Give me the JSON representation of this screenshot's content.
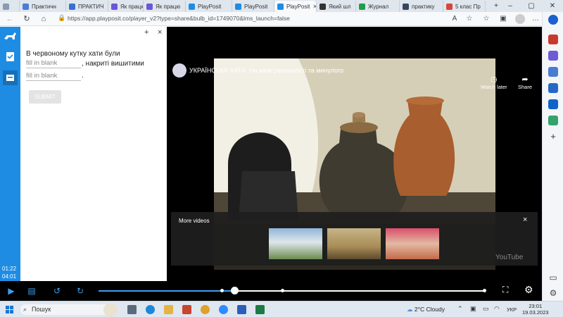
{
  "browser": {
    "tabs": [
      {
        "label": "Практичн",
        "favicon_color": "#4a7dd8",
        "active": false
      },
      {
        "label": "ПРАКТИЧ",
        "favicon_color": "#3a6fd0",
        "active": false
      },
      {
        "label": "Як працю",
        "favicon_color": "#6b57d6",
        "active": false
      },
      {
        "label": "Як працю",
        "favicon_color": "#6b57d6",
        "active": false
      },
      {
        "label": "PlayPosit",
        "favicon_color": "#1f8ce3",
        "active": false
      },
      {
        "label": "PlayPosit",
        "favicon_color": "#1f8ce3",
        "active": false
      },
      {
        "label": "PlayPosit",
        "favicon_color": "#1f8ce3",
        "active": true
      },
      {
        "label": "Який шл",
        "favicon_color": "#333333",
        "active": false
      },
      {
        "label": "Журнал",
        "favicon_color": "#1e9e4a",
        "active": false
      },
      {
        "label": "практику",
        "favicon_color": "#39465a",
        "active": false
      },
      {
        "label": "5 клас Пр",
        "favicon_color": "#d6453a",
        "active": false
      }
    ],
    "url": "https://app.playposit.co/player_v2?type=share&bulb_id=1749070&lms_launch=false"
  },
  "player": {
    "time_current": "01:22",
    "time_total": "04:01",
    "progress_fraction": 0.35
  },
  "question": {
    "text_part1": "В червоному кутку хати були",
    "blank1_placeholder": "fill in blank",
    "text_part2": ", накриті вишитими",
    "blank2_placeholder": "fill in blank",
    "end_dot": ".",
    "submit_label": "SUBMIT",
    "add_label": "+",
    "close_label": "×"
  },
  "video": {
    "title": "УКРАЇНСЬКА ХАТА. На межі реальності та минулого",
    "watch_later": "Watch later",
    "share": "Share",
    "more_videos_label": "More videos",
    "close_label": "×",
    "brand": "YouTube"
  },
  "taskbar": {
    "search_label": "Пошук",
    "weather": "2°C  Cloudy",
    "language": "УКР",
    "time": "23:01",
    "date": "19.03.2023"
  }
}
